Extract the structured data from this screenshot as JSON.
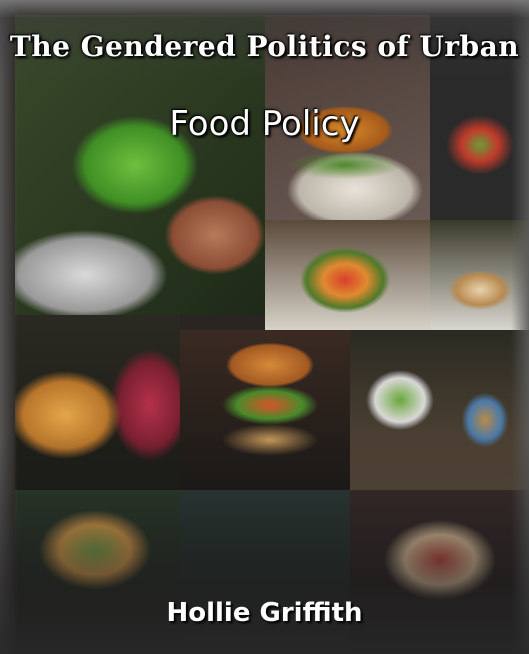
{
  "book": {
    "title_line1": "The Gendered Politics of Urban",
    "title_line2": "Food Policy",
    "author": "Hollie Griffith"
  }
}
